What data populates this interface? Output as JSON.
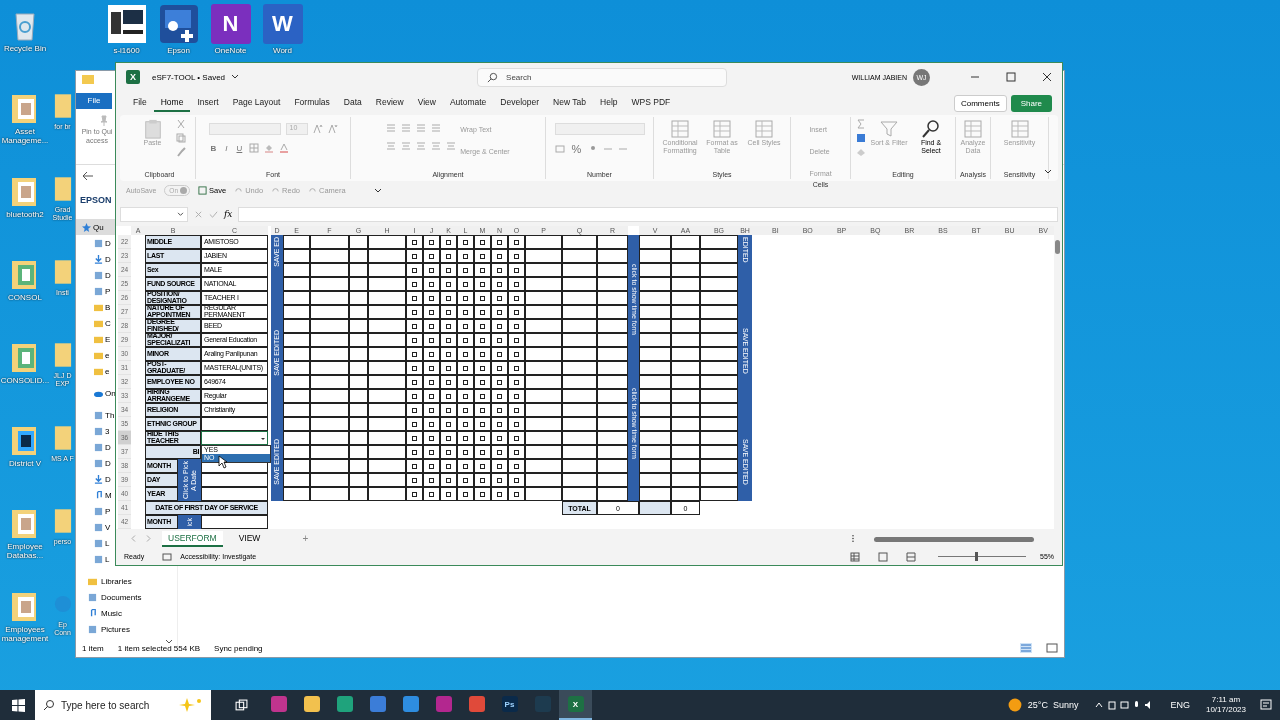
{
  "desktop": {
    "top_icons": [
      {
        "label": "s-i1600",
        "kind": "computer"
      },
      {
        "label": "Epson",
        "kind": "epson"
      },
      {
        "label": "OneNote",
        "kind": "letter",
        "glyph": "N",
        "color": "#7b2fbe"
      },
      {
        "label": "Word",
        "kind": "letter",
        "glyph": "W",
        "color": "#2b62c4"
      }
    ],
    "column_1": [
      {
        "label": "Recycle Bin",
        "kind": "recycle"
      },
      {
        "label": "Asset Manageme...",
        "kind": "folder"
      },
      {
        "label": "bluetooth2",
        "kind": "folder"
      },
      {
        "label": "CONSOL",
        "kind": "sheet"
      },
      {
        "label": "CONSOLID...",
        "kind": "sheet"
      },
      {
        "label": "District V",
        "kind": "ps"
      },
      {
        "label": "Employee Databas...",
        "kind": "folder"
      },
      {
        "label": "Employees management",
        "kind": "folder"
      }
    ],
    "column_2": [
      {
        "label": "for br",
        "kind": "folder"
      },
      {
        "label": "Grad Studie",
        "kind": "folder"
      },
      {
        "label": "Insti",
        "kind": "folder"
      },
      {
        "label": "JLJ D EXP",
        "kind": "folder"
      },
      {
        "label": "MS A F",
        "kind": "folder"
      },
      {
        "label": "perso",
        "kind": "folder"
      },
      {
        "label": "Ep Conn",
        "kind": "edge"
      }
    ]
  },
  "explorer": {
    "file_tab": "File",
    "pin_label": "Pin to Qui access",
    "location": "EPSON",
    "nav": [
      {
        "label": "Qu",
        "kind": "star",
        "selected": true
      },
      {
        "label": "D",
        "kind": "desk",
        "selected": false
      },
      {
        "label": "D",
        "kind": "down",
        "selected": false
      },
      {
        "label": "D",
        "kind": "doc",
        "selected": false
      },
      {
        "label": "P",
        "kind": "pic",
        "selected": false
      },
      {
        "label": "B",
        "kind": "folder",
        "selected": false
      },
      {
        "label": "C",
        "kind": "folder",
        "selected": false
      },
      {
        "label": "E",
        "kind": "folder",
        "selected": false
      },
      {
        "label": "e",
        "kind": "folder",
        "selected": false
      },
      {
        "label": "e",
        "kind": "folder",
        "selected": false
      },
      {
        "label": "On",
        "kind": "cloud",
        "selected": false
      },
      {
        "label": "Th",
        "kind": "pc",
        "selected": false
      },
      {
        "label": "3",
        "kind": "cube",
        "selected": false
      },
      {
        "label": "D",
        "kind": "desk",
        "selected": false
      },
      {
        "label": "D",
        "kind": "doc",
        "selected": false
      },
      {
        "label": "D",
        "kind": "down",
        "selected": false
      },
      {
        "label": "M",
        "kind": "music",
        "selected": false
      },
      {
        "label": "P",
        "kind": "pic",
        "selected": false
      },
      {
        "label": "V",
        "kind": "video",
        "selected": false
      },
      {
        "label": "L",
        "kind": "drive",
        "selected": false
      },
      {
        "label": "L",
        "kind": "drive",
        "selected": false
      },
      {
        "label": "Libraries",
        "kind": "folder",
        "selected": false
      },
      {
        "label": "Documents",
        "kind": "doc",
        "selected": false
      },
      {
        "label": "Music",
        "kind": "music",
        "selected": false
      },
      {
        "label": "Pictures",
        "kind": "pic",
        "selected": false
      }
    ],
    "status": [
      "1 item",
      "1 item selected  554 KB",
      "Sync pending"
    ]
  },
  "excel": {
    "app_glyph": "X",
    "title": "eSF7-TOOL • Saved",
    "search_placeholder": "Search",
    "user": "WILLIAM JABIEN",
    "avatar": "WJ",
    "menu": [
      {
        "label": "File",
        "selected": false
      },
      {
        "label": "Home",
        "selected": true
      },
      {
        "label": "Insert",
        "selected": false
      },
      {
        "label": "Page Layout",
        "selected": false
      },
      {
        "label": "Formulas",
        "selected": false
      },
      {
        "label": "Data",
        "selected": false
      },
      {
        "label": "Review",
        "selected": false
      },
      {
        "label": "View",
        "selected": false
      },
      {
        "label": "Automate",
        "selected": false
      },
      {
        "label": "Developer",
        "selected": false
      },
      {
        "label": "New Tab",
        "selected": false
      },
      {
        "label": "Help",
        "selected": false
      },
      {
        "label": "WPS PDF",
        "selected": false
      }
    ],
    "comments": "Comments",
    "share": "Share",
    "ribbon": [
      {
        "name": "Clipboard",
        "kind": "clipboard",
        "tools": [
          "Paste"
        ]
      },
      {
        "name": "Font",
        "kind": "font",
        "tools": [
          "10",
          "B",
          "I",
          "U"
        ]
      },
      {
        "name": "Alignment",
        "kind": "alignment",
        "tools": [
          "Wrap Text",
          "Merge & Center"
        ]
      },
      {
        "name": "Number",
        "kind": "number",
        "tools": [
          "%"
        ]
      },
      {
        "name": "Styles",
        "kind": "large",
        "tools": [
          "Conditional Formatting",
          "Format as Table",
          "Cell Styles"
        ]
      },
      {
        "name": "Cells",
        "kind": "cells",
        "tools": [
          "Insert",
          "Delete",
          "Format"
        ]
      },
      {
        "name": "Editing",
        "kind": "editing",
        "tools": [
          "Sort & Filter",
          "Find & Select"
        ]
      },
      {
        "name": "Analysis",
        "kind": "large",
        "tools": [
          "Analyze Data"
        ]
      },
      {
        "name": "Sensitivity",
        "kind": "large",
        "tools": [
          "Sensitivity"
        ]
      }
    ],
    "quick_access": {
      "autosave": "AutoSave",
      "autosave_state": "On",
      "tools": [
        "Save",
        "Undo",
        "Redo",
        "Camera"
      ]
    },
    "fx": "fx",
    "column_headers": [
      "A",
      "B",
      "C",
      "D",
      "E",
      "F",
      "G",
      "H",
      "I",
      "J",
      "K",
      "L",
      "M",
      "N",
      "O",
      "P",
      "Q",
      "R",
      "V",
      "AA",
      "BG",
      "BH",
      "BI",
      "BO",
      "BP",
      "BQ",
      "BR",
      "BS",
      "BT",
      "BU",
      "BV"
    ],
    "row_numbers": [
      "22",
      "23",
      "24",
      "25",
      "26",
      "27",
      "28",
      "29",
      "30",
      "31",
      "32",
      "33",
      "34",
      "35",
      "36",
      "37",
      "38",
      "39",
      "40",
      "41",
      "42"
    ],
    "form": {
      "fields": [
        {
          "label": "MIDDLE",
          "value": "AMISTOSO",
          "active": false
        },
        {
          "label": "LAST",
          "value": "JABIEN",
          "active": false
        },
        {
          "label": "Sex",
          "value": "MALE",
          "active": false
        },
        {
          "label": "FUND SOURCE",
          "value": "NATIONAL",
          "active": false
        },
        {
          "label": "POSITION/ DESIGNATIO",
          "value": "TEACHER I",
          "active": false
        },
        {
          "label": "NATURE OF APPOINTMEN",
          "value": "REGULAR PERMANENT",
          "active": false
        },
        {
          "label": "DEGREE FINISHED/",
          "value": "BEED",
          "active": false
        },
        {
          "label": "MAJOR/ SPECIALIZATI",
          "value": "General Education",
          "active": false
        },
        {
          "label": "MINOR",
          "value": "Araling Panlipunan",
          "active": false
        },
        {
          "label": "POST-GRADUATE/",
          "value": "MASTERAL(UNITS)",
          "active": false
        },
        {
          "label": "EMPLOYEE NO",
          "value": "649674",
          "active": false
        },
        {
          "label": "HIRING ARRANGEME",
          "value": "Regular",
          "active": false
        },
        {
          "label": "RELIGION",
          "value": "Christianity",
          "active": false
        },
        {
          "label": "ETHNIC GROUP",
          "active": false
        },
        {
          "label": "HIDE THIS TEACHER",
          "active": true
        }
      ],
      "section_1": "BI",
      "date_fields": [
        "MONTH",
        "DAY",
        "YEAR"
      ],
      "date_button": "Click to Pick A Date",
      "section_2": "DATE OF FIRST DAY OF SERVICE",
      "date_fields_2": [
        "MONTH"
      ],
      "date_button_2": "ick",
      "dropdown": [
        {
          "label": "YES",
          "selected": false
        },
        {
          "label": "NO",
          "selected": true
        }
      ]
    },
    "bars": [
      {
        "kind": "up",
        "texts": [
          "SAVE ED",
          "SAVE EDITED",
          "SAVE EDITED"
        ]
      },
      {
        "kind": "down",
        "texts": [
          "click to show time form",
          "click to show time form"
        ]
      },
      {
        "kind": "down",
        "texts": [
          "EDITED",
          "SAVE EDITED",
          "SAVE EDITED"
        ]
      }
    ],
    "checks": [
      [
        false,
        false,
        false,
        false,
        false,
        false,
        false
      ],
      [
        false,
        false,
        false,
        false,
        false,
        false,
        false
      ],
      [
        false,
        false,
        false,
        false,
        false,
        false,
        false
      ],
      [
        false,
        false,
        false,
        false,
        false,
        false,
        false
      ],
      [
        false,
        false,
        false,
        false,
        false,
        false,
        false
      ],
      [
        false,
        false,
        false,
        false,
        false,
        false,
        false
      ],
      [
        false,
        false,
        false,
        false,
        false,
        false,
        false
      ],
      [
        false,
        false,
        false,
        false,
        false,
        false,
        false
      ],
      [
        false,
        false,
        false,
        false,
        false,
        false,
        false
      ],
      [
        false,
        false,
        false,
        false,
        false,
        false,
        false
      ],
      [
        false,
        false,
        false,
        false,
        false,
        false,
        false
      ],
      [
        false,
        false,
        false,
        false,
        false,
        false,
        false
      ],
      [
        false,
        false,
        false,
        false,
        false,
        false,
        false
      ],
      [
        false,
        false,
        false,
        false,
        false,
        false,
        false
      ],
      [
        false,
        false,
        false,
        false,
        false,
        false,
        false
      ],
      [
        false,
        false,
        false,
        false,
        false,
        false,
        false
      ],
      [
        false,
        false,
        false,
        false,
        false,
        false,
        false
      ],
      [
        false,
        false,
        false,
        false,
        false,
        false,
        false
      ],
      [
        false,
        false,
        false,
        false,
        false,
        false,
        false
      ]
    ],
    "totals": {
      "label": "TOTAL",
      "values": [
        "0",
        "0"
      ]
    },
    "sheet_tabs": [
      {
        "label": "USERFORM",
        "selected": true
      },
      {
        "label": "VIEW",
        "selected": false
      }
    ],
    "add_sheet": "+",
    "status": {
      "ready": "Ready",
      "accessibility": "Accessibility: Investigate",
      "zoom": "55%",
      "level": 0.42
    }
  },
  "taskbar": {
    "search_placeholder": "Type here to search",
    "apps": [
      {
        "kind": "wps",
        "selected": false
      },
      {
        "kind": "files",
        "selected": false
      },
      {
        "kind": "edge",
        "selected": false
      },
      {
        "kind": "store",
        "selected": false
      },
      {
        "kind": "mail",
        "selected": false
      },
      {
        "kind": "red",
        "selected": false
      },
      {
        "kind": "chrome",
        "selected": false
      },
      {
        "kind": "ps",
        "glyph": "Ps",
        "selected": false
      },
      {
        "kind": "dl",
        "selected": false
      },
      {
        "kind": "excel",
        "glyph": "X",
        "selected": true
      }
    ],
    "weather": "25°C  Sunny",
    "language": "ENG",
    "time": "7:11 am",
    "date": "10/17/2023"
  }
}
